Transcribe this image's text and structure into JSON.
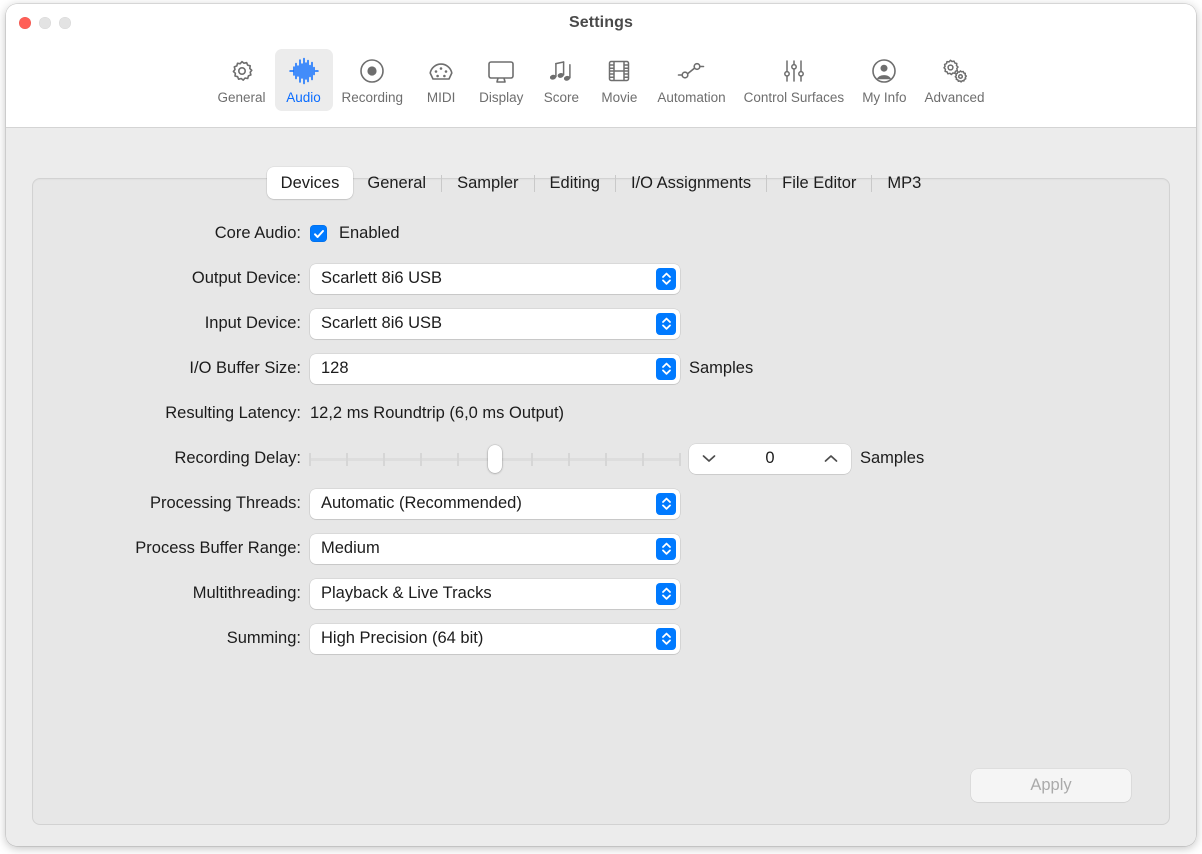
{
  "window": {
    "title": "Settings",
    "traffic_lights": [
      "close",
      "minimize",
      "zoom"
    ]
  },
  "toolbar": {
    "items": [
      {
        "label": "General",
        "icon": "gear-icon",
        "selected": false
      },
      {
        "label": "Audio",
        "icon": "waveform-icon",
        "selected": true
      },
      {
        "label": "Recording",
        "icon": "record-circle-icon",
        "selected": false
      },
      {
        "label": "MIDI",
        "icon": "midi-connector-icon",
        "selected": false
      },
      {
        "label": "Display",
        "icon": "monitor-icon",
        "selected": false
      },
      {
        "label": "Score",
        "icon": "music-notes-icon",
        "selected": false
      },
      {
        "label": "Movie",
        "icon": "film-strip-icon",
        "selected": false
      },
      {
        "label": "Automation",
        "icon": "automation-node-icon",
        "selected": false
      },
      {
        "label": "Control Surfaces",
        "icon": "sliders-icon",
        "selected": false
      },
      {
        "label": "My Info",
        "icon": "person-circle-icon",
        "selected": false
      },
      {
        "label": "Advanced",
        "icon": "double-gear-icon",
        "selected": false
      }
    ],
    "accent_color": "#0a6cff",
    "inactive_color": "#6e6e6e"
  },
  "tabs": [
    {
      "label": "Devices",
      "active": true
    },
    {
      "label": "General",
      "active": false
    },
    {
      "label": "Sampler",
      "active": false
    },
    {
      "label": "Editing",
      "active": false
    },
    {
      "label": "I/O Assignments",
      "active": false
    },
    {
      "label": "File Editor",
      "active": false
    },
    {
      "label": "MP3",
      "active": false
    }
  ],
  "form": {
    "core_audio": {
      "label": "Core Audio:",
      "checkbox_label": "Enabled",
      "checked": true
    },
    "output_device": {
      "label": "Output Device:",
      "value": "Scarlett 8i6 USB"
    },
    "input_device": {
      "label": "Input Device:",
      "value": "Scarlett 8i6 USB"
    },
    "io_buffer_size": {
      "label": "I/O Buffer Size:",
      "value": "128",
      "unit": "Samples"
    },
    "resulting_latency": {
      "label": "Resulting Latency:",
      "value": "12,2 ms Roundtrip (6,0 ms Output)"
    },
    "recording_delay": {
      "label": "Recording Delay:",
      "slider_value": 0,
      "slider_min": -5,
      "slider_max": 5,
      "slider_ticks": 11,
      "slider_thumb_percent": 50,
      "stepper_value": "0",
      "unit": "Samples"
    },
    "processing_threads": {
      "label": "Processing Threads:",
      "value": "Automatic (Recommended)"
    },
    "process_buffer_range": {
      "label": "Process Buffer Range:",
      "value": "Medium"
    },
    "multithreading": {
      "label": "Multithreading:",
      "value": "Playback & Live Tracks"
    },
    "summing": {
      "label": "Summing:",
      "value": "High Precision (64 bit)"
    }
  },
  "apply_button": {
    "label": "Apply",
    "enabled": false
  },
  "colors": {
    "accent_blue": "#007aff",
    "toolbar_selected_blue": "#0a6cff",
    "panel_background": "#e7e7e7",
    "window_background": "#ececec",
    "close_red": "#ff5f57"
  }
}
